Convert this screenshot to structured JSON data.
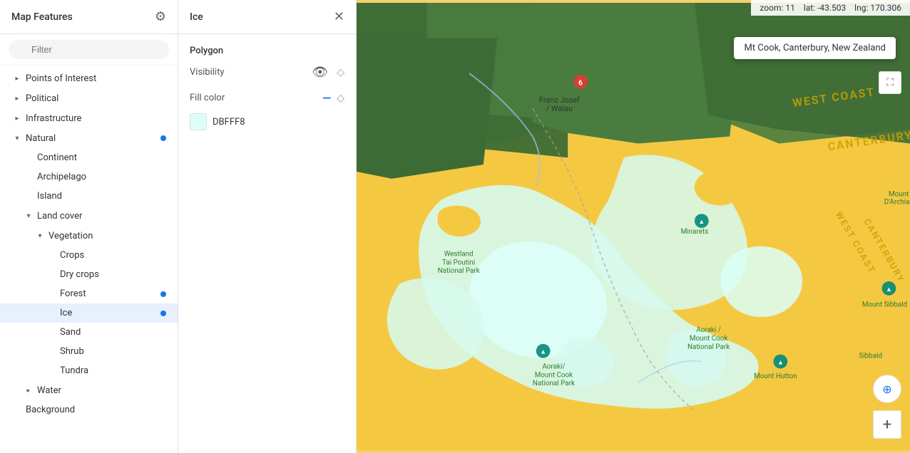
{
  "sidebar": {
    "title": "Map Features",
    "filter_placeholder": "Filter",
    "items": [
      {
        "id": "points-of-interest",
        "label": "Points of Interest",
        "level": 1,
        "has_chevron": true,
        "chevron_dir": "right",
        "active": false,
        "has_dot": false
      },
      {
        "id": "political",
        "label": "Political",
        "level": 1,
        "has_chevron": true,
        "chevron_dir": "right",
        "active": false,
        "has_dot": false
      },
      {
        "id": "infrastructure",
        "label": "Infrastructure",
        "level": 1,
        "has_chevron": true,
        "chevron_dir": "right",
        "active": false,
        "has_dot": false
      },
      {
        "id": "natural",
        "label": "Natural",
        "level": 1,
        "has_chevron": true,
        "chevron_dir": "down",
        "active": false,
        "has_dot": true
      },
      {
        "id": "continent",
        "label": "Continent",
        "level": 2,
        "has_chevron": false,
        "active": false,
        "has_dot": false
      },
      {
        "id": "archipelago",
        "label": "Archipelago",
        "level": 2,
        "has_chevron": false,
        "active": false,
        "has_dot": false
      },
      {
        "id": "island",
        "label": "Island",
        "level": 2,
        "has_chevron": false,
        "active": false,
        "has_dot": false
      },
      {
        "id": "land-cover",
        "label": "Land cover",
        "level": 2,
        "has_chevron": true,
        "chevron_dir": "down",
        "active": false,
        "has_dot": false
      },
      {
        "id": "vegetation",
        "label": "Vegetation",
        "level": 3,
        "has_chevron": true,
        "chevron_dir": "down",
        "active": false,
        "has_dot": false
      },
      {
        "id": "crops",
        "label": "Crops",
        "level": 4,
        "has_chevron": false,
        "active": false,
        "has_dot": false
      },
      {
        "id": "dry-crops",
        "label": "Dry crops",
        "level": 4,
        "has_chevron": false,
        "active": false,
        "has_dot": false
      },
      {
        "id": "forest",
        "label": "Forest",
        "level": 4,
        "has_chevron": false,
        "active": false,
        "has_dot": true
      },
      {
        "id": "ice",
        "label": "Ice",
        "level": 4,
        "has_chevron": false,
        "active": true,
        "has_dot": true
      },
      {
        "id": "sand",
        "label": "Sand",
        "level": 4,
        "has_chevron": false,
        "active": false,
        "has_dot": false
      },
      {
        "id": "shrub",
        "label": "Shrub",
        "level": 4,
        "has_chevron": false,
        "active": false,
        "has_dot": false
      },
      {
        "id": "tundra",
        "label": "Tundra",
        "level": 4,
        "has_chevron": false,
        "active": false,
        "has_dot": false
      },
      {
        "id": "water",
        "label": "Water",
        "level": 2,
        "has_chevron": true,
        "chevron_dir": "right",
        "active": false,
        "has_dot": false
      },
      {
        "id": "background",
        "label": "Background",
        "level": 1,
        "has_chevron": false,
        "active": false,
        "has_dot": false
      }
    ]
  },
  "detail": {
    "title": "Ice",
    "section_title": "Polygon",
    "visibility_label": "Visibility",
    "fill_color_label": "Fill color",
    "fill_color_value": "DBFFF8",
    "fill_color_hex": "#DBFFF8"
  },
  "map": {
    "zoom_label": "zoom:",
    "zoom_value": "11",
    "lat_label": "lat:",
    "lat_value": "-43.503",
    "lng_label": "lng:",
    "lng_value": "170.306",
    "location_name": "Mt Cook, Canterbury, New Zealand",
    "labels": [
      "WEST COAST",
      "CANTERBURY",
      "Franz Josef / Walau",
      "Westland Tai Poutini National Park",
      "Minarets",
      "Mount D'Archiac",
      "Mount Sibbald",
      "Aoraki / Mount Cook National Park",
      "Aoraki/ Mount Cook National Park",
      "Mount Hutton",
      "Sibbald"
    ]
  }
}
